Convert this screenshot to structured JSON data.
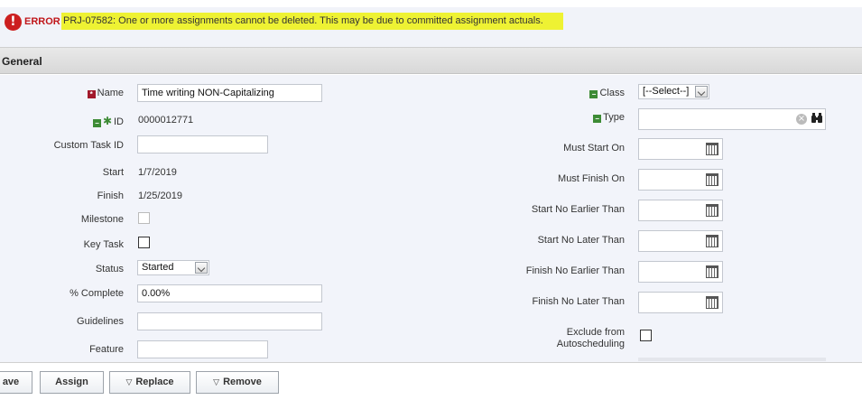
{
  "error": {
    "label": "ERROR",
    "message": "PRJ-07582: One or more assignments cannot be deleted. This may be due to committed assignment actuals."
  },
  "section": {
    "title": "General"
  },
  "left": {
    "name_label": "Name",
    "name_value": "Time writing NON-Capitalizing",
    "id_label": "ID",
    "id_value": "0000012771",
    "custom_task_id_label": "Custom Task ID",
    "custom_task_id_value": "",
    "start_label": "Start",
    "start_value": "1/7/2019",
    "finish_label": "Finish",
    "finish_value": "1/25/2019",
    "milestone_label": "Milestone",
    "key_task_label": "Key Task",
    "status_label": "Status",
    "status_value": "Started",
    "pct_complete_label": "% Complete",
    "pct_complete_value": "0.00%",
    "guidelines_label": "Guidelines",
    "guidelines_value": "",
    "feature_label": "Feature",
    "feature_value": ""
  },
  "right": {
    "class_label": "Class",
    "class_value": "[--Select--]",
    "type_label": "Type",
    "type_value": "",
    "must_start_on_label": "Must Start On",
    "must_finish_on_label": "Must Finish On",
    "start_no_earlier_label": "Start No Earlier Than",
    "start_no_later_label": "Start No Later Than",
    "finish_no_earlier_label": "Finish No Earlier Than",
    "finish_no_later_label": "Finish No Later Than",
    "exclude_label_line1": "Exclude from",
    "exclude_label_line2": "Autoscheduling"
  },
  "buttons": {
    "save": "ave",
    "assign": "Assign",
    "replace": "Replace",
    "remove": "Remove"
  },
  "colors": {
    "error_red": "#c0161a",
    "highlight_yellow": "#eef233",
    "form_bg": "#f2f4fa"
  }
}
